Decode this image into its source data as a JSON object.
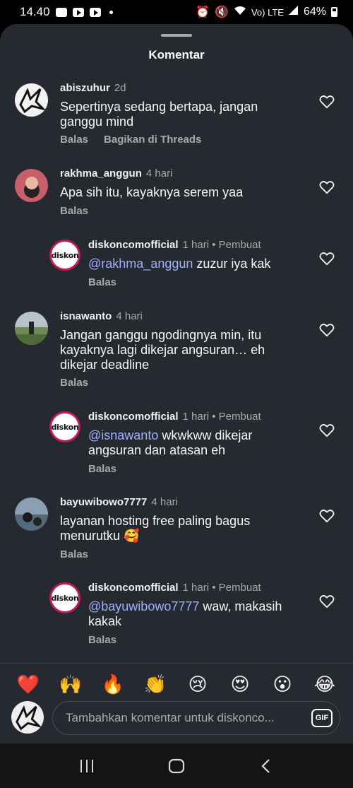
{
  "status_bar": {
    "time": "14.40",
    "network": "Vo) LTE",
    "battery": "64%"
  },
  "sheet": {
    "title": "Komentar"
  },
  "comments": [
    {
      "username": "abiszuhur",
      "time": "2d",
      "text": "Sepertinya sedang bertapa, jangan ganggu mind",
      "reply_label": "Balas",
      "share_label": "Bagikan di Threads"
    },
    {
      "username": "rakhma_anggun",
      "time": "4 hari",
      "text": "Apa sih itu, kayaknya serem yaa",
      "reply_label": "Balas"
    },
    {
      "username": "diskoncomofficial",
      "time": "1 hari",
      "creator_label": "• Pembuat",
      "mention": "@rakhma_anggun",
      "text": " zuzur iya kak",
      "reply_label": "Balas"
    },
    {
      "username": "isnawanto",
      "time": "4 hari",
      "text": "Jangan ganggu ngodingnya min, itu kayaknya lagi dikejar angsuran… eh dikejar deadline",
      "reply_label": "Balas"
    },
    {
      "username": "diskoncomofficial",
      "time": "1 hari",
      "creator_label": "• Pembuat",
      "mention": "@isnawanto",
      "text": " wkwkww dikejar angsuran dan atasan eh",
      "reply_label": "Balas"
    },
    {
      "username": "bayuwibowo7777",
      "time": "4 hari",
      "text": "layanan hosting free paling bagus menurutku 🥰",
      "reply_label": "Balas"
    },
    {
      "username": "diskoncomofficial",
      "time": "1 hari",
      "creator_label": "• Pembuat",
      "mention": "@bayuwibowo7777",
      "text": " waw, makasih kakak",
      "reply_label": "Balas"
    }
  ],
  "brand_logo_text": "diskon",
  "reactions": [
    "❤️",
    "🙌",
    "🔥",
    "👏",
    "😢",
    "😍",
    "😮",
    "😂"
  ],
  "composer": {
    "placeholder": "Tambahkan komentar untuk diskonco...",
    "gif_label": "GIF"
  },
  "colors": {
    "sheet_bg": "#262a30",
    "mention": "#9db0ff",
    "creator_ring": "#c2195a"
  }
}
